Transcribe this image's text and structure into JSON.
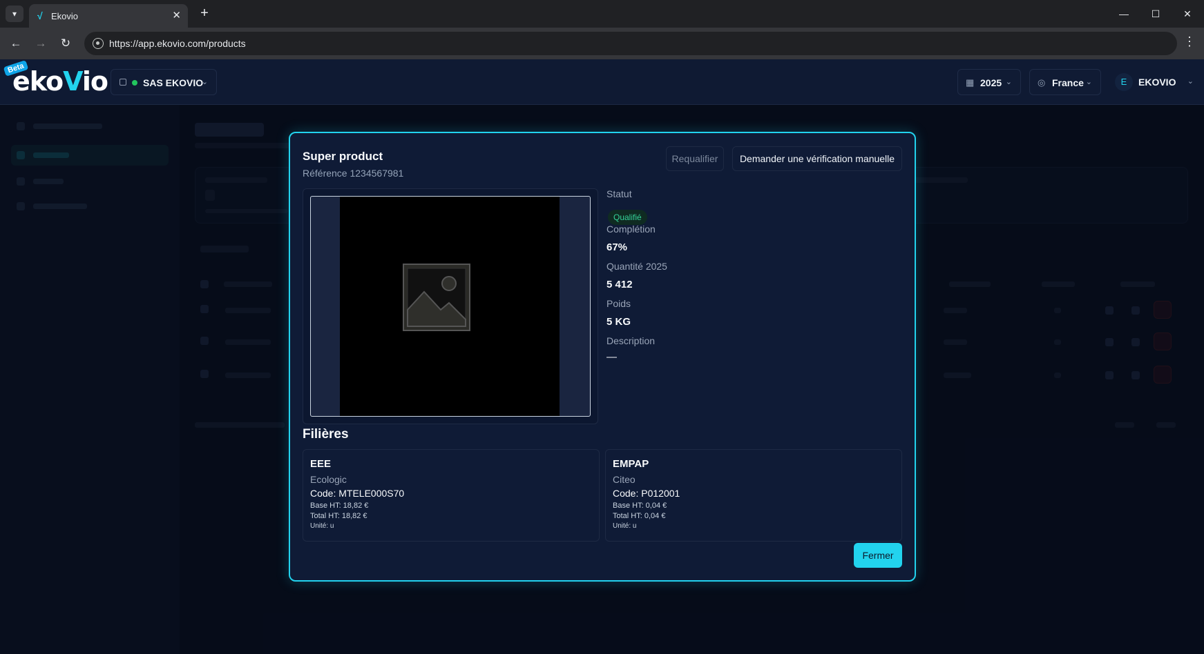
{
  "browser": {
    "tab_title": "Ekovio",
    "url": "https://app.ekovio.com/products"
  },
  "header": {
    "logo_prefix": "eko",
    "logo_v": "V",
    "logo_suffix": "io",
    "beta": "Beta",
    "org": "SAS EKOVIO",
    "year": "2025",
    "country": "France",
    "user_initial": "E",
    "user_name": "EKOVIO"
  },
  "modal": {
    "title": "Super product",
    "reference": "Référence 1234567981",
    "requalify": "Requalifier",
    "manual_check": "Demander une vérification manuelle",
    "status_label": "Statut",
    "status_value": "Qualifié",
    "completion_label": "Complétion",
    "completion_value": "67%",
    "quantity_label": "Quantité 2025",
    "quantity_value": "5 412",
    "weight_label": "Poids",
    "weight_value": "5 KG",
    "description_label": "Description",
    "description_value": "—",
    "filieres_title": "Filières",
    "filieres": [
      {
        "name": "EEE",
        "org": "Ecologic",
        "code": "Code: MTELE000S70",
        "base": "Base HT: 18,82 €",
        "total": "Total HT: 18,82 €",
        "unit": "Unité: u"
      },
      {
        "name": "EMPAP",
        "org": "Citeo",
        "code": "Code: P012001",
        "base": "Base HT: 0,04 €",
        "total": "Total HT: 0,04 €",
        "unit": "Unité: u"
      }
    ],
    "close": "Fermer"
  },
  "colors": {
    "accent": "#22d3ee",
    "background": "#0a1122",
    "modal_bg": "#0f1b36",
    "status_green": "#34d399"
  }
}
